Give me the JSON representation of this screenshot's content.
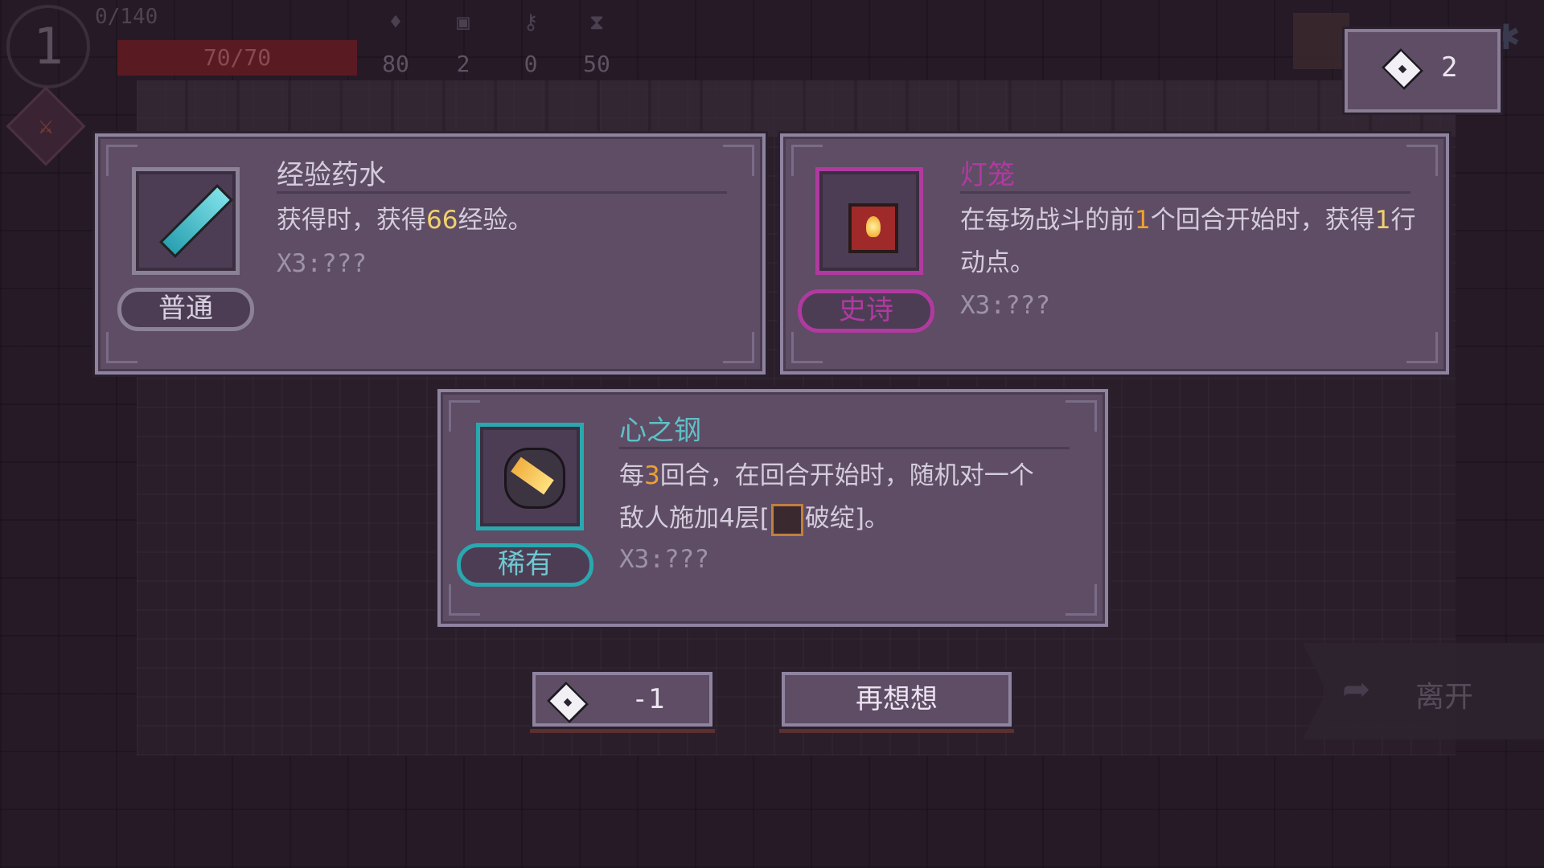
{
  "hud": {
    "level": "1",
    "exp": "0/140",
    "hp": "70/70",
    "stats": [
      {
        "icon": "gem-icon",
        "value": "80"
      },
      {
        "icon": "dice-icon",
        "value": "2"
      },
      {
        "icon": "key-icon",
        "value": "0"
      },
      {
        "icon": "hourglass-icon",
        "value": "50"
      }
    ]
  },
  "dice_counter": {
    "count": "2"
  },
  "cards": [
    {
      "name": "经验药水",
      "rarity": "普通",
      "desc_a": "获得时，获得",
      "desc_num": "66",
      "desc_b": "经验。",
      "extra": "X3:???"
    },
    {
      "name": "灯笼",
      "rarity": "史诗",
      "desc_a": "在每场战斗的前",
      "desc_num": "1",
      "desc_b": "个回合开始时，获得",
      "desc_num2": "1",
      "desc_c": "行动点。",
      "extra": "X3:???"
    },
    {
      "name": "心之钢",
      "rarity": "稀有",
      "desc_a": "每",
      "desc_num": "3",
      "desc_b": "回合，在回合开始时，随机对一个",
      "desc_c": "敌人施加4层[",
      "desc_status": "破绽",
      "desc_d": "]。",
      "extra": "X3:???"
    }
  ],
  "buttons": {
    "reroll": "-1",
    "rethink": "再想想",
    "leave": "离开"
  },
  "colors": {
    "panel": "#5e4d65",
    "panel_border": "#8f84a0",
    "common": "#8c8298",
    "epic": "#b03aa0",
    "rare": "#2aa8b0",
    "highlight_yellow": "#f0d070",
    "highlight_orange": "#f0a030"
  }
}
